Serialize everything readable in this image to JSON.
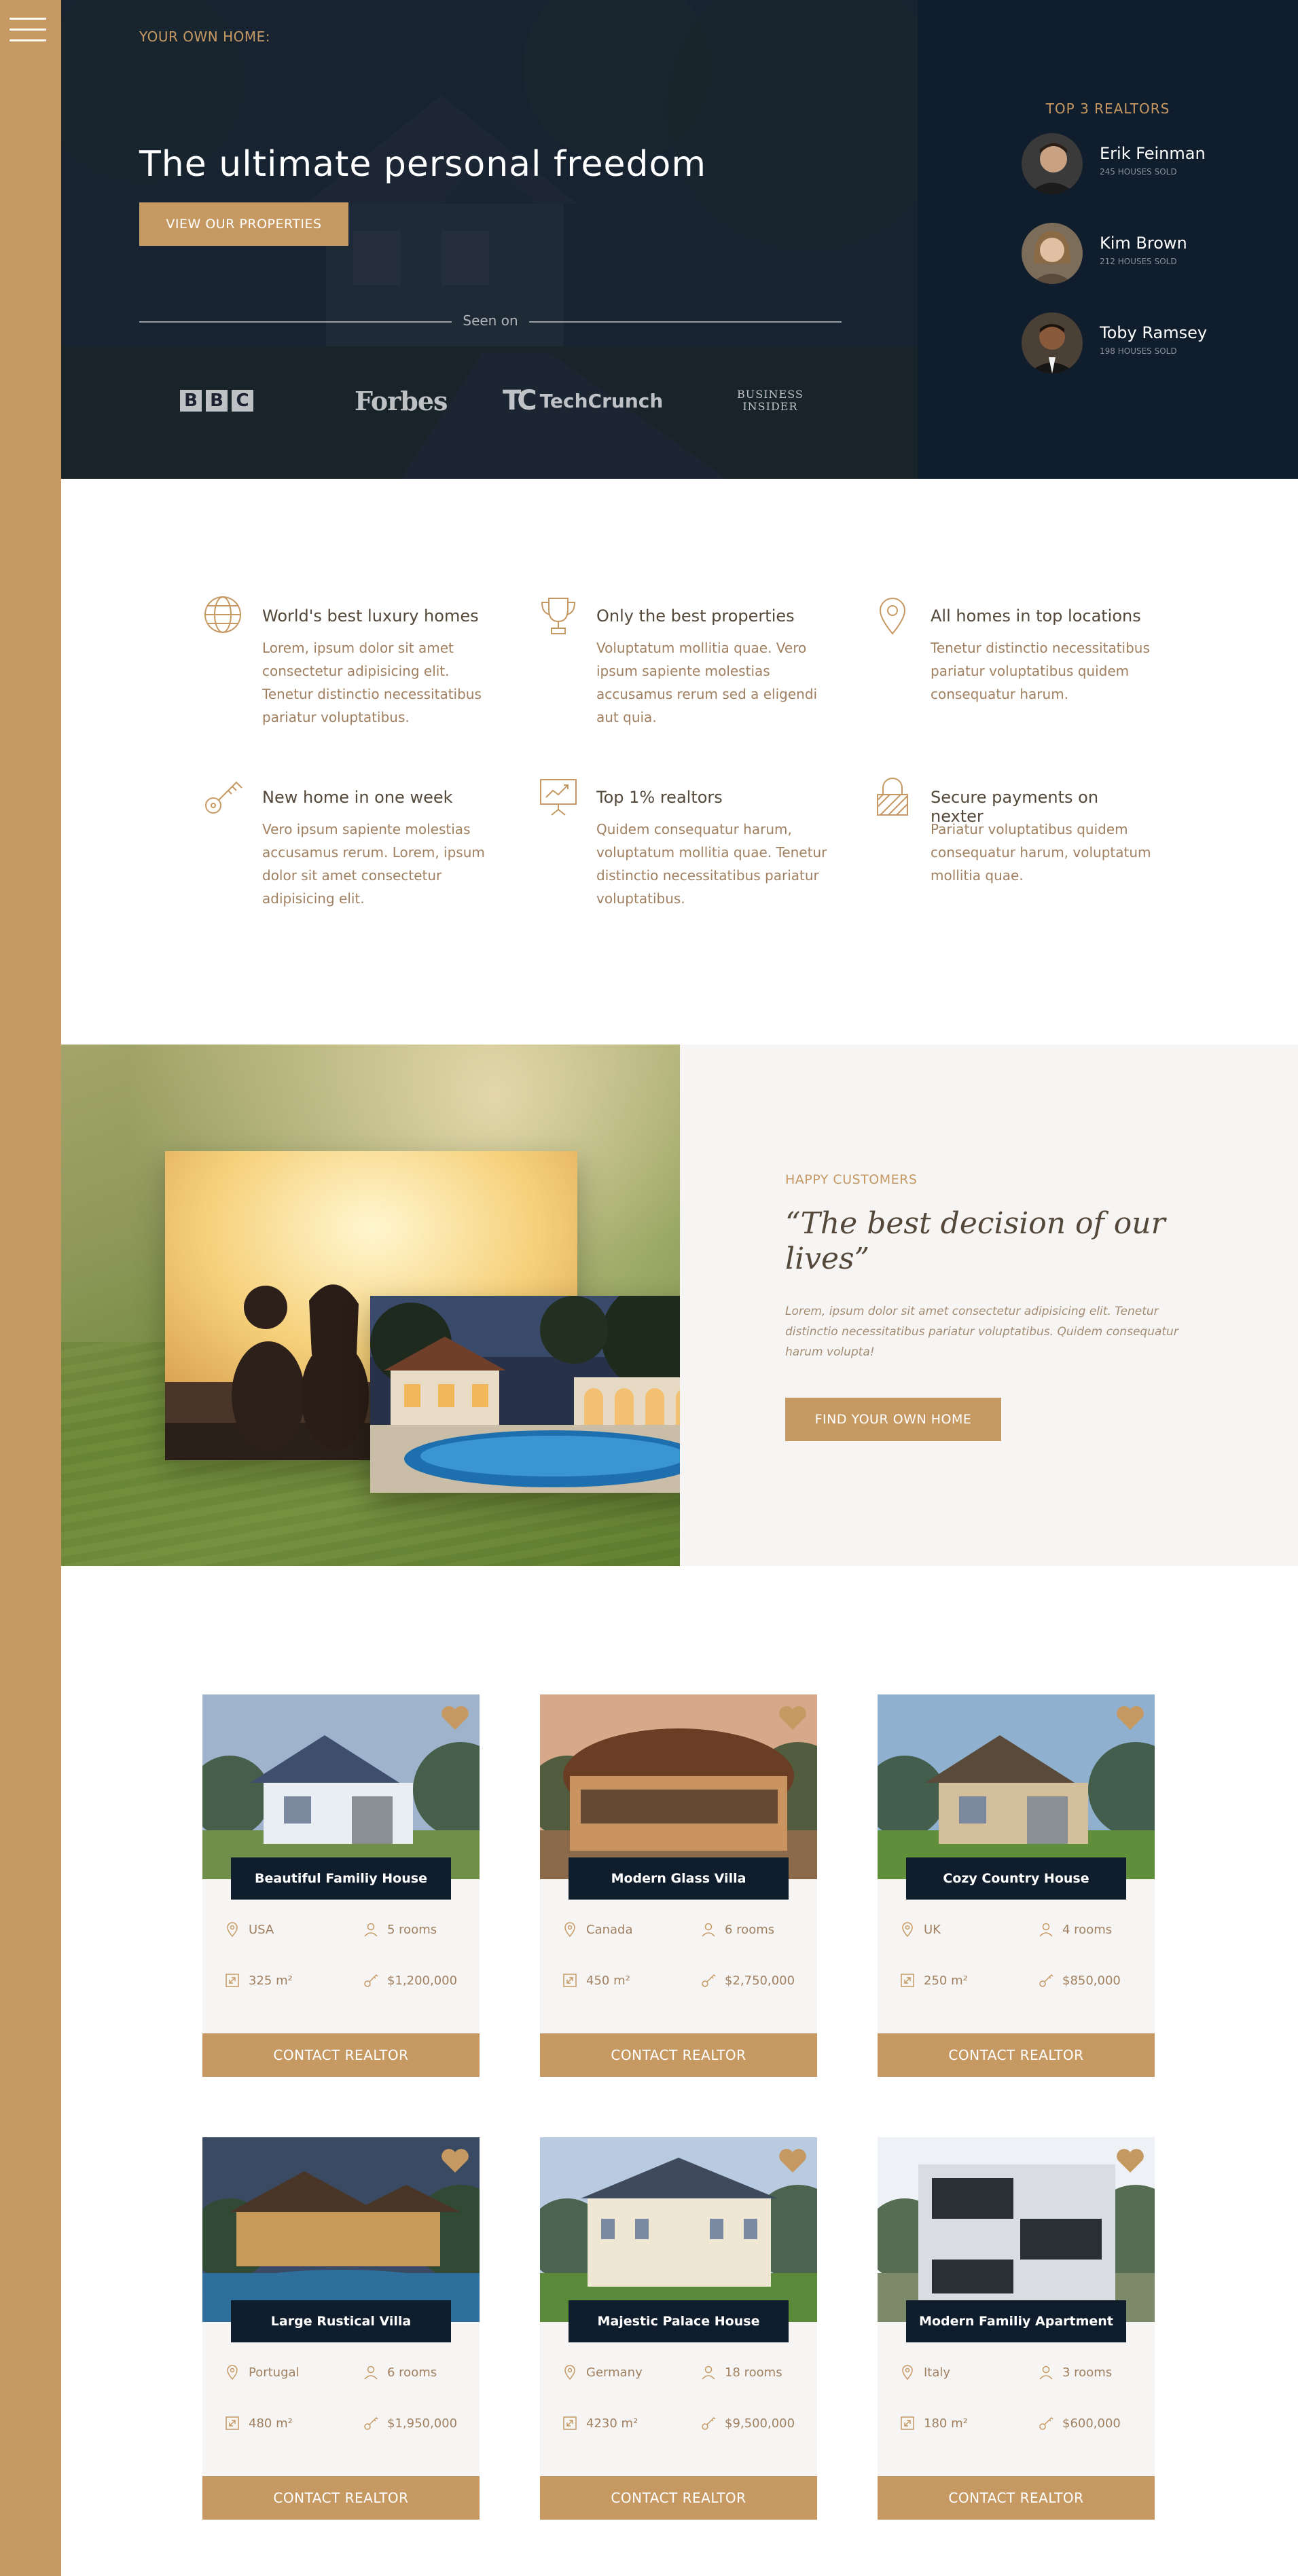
{
  "hero": {
    "tagline": "YOUR OWN HOME:",
    "title": "The ultimate personal freedom",
    "cta": "VIEW OUR PROPERTIES",
    "seen_on": "Seen on",
    "logos": {
      "bbc": [
        "B",
        "B",
        "C"
      ],
      "forbes": "Forbes",
      "techcrunch_mark": "TC",
      "techcrunch": "TechCrunch",
      "bi_line1": "BUSINESS",
      "bi_line2": "INSIDER"
    }
  },
  "realtors": {
    "title": "TOP 3 REALTORS",
    "list": [
      {
        "name": "Erik Feinman",
        "sold": "245 HOUSES SOLD"
      },
      {
        "name": "Kim Brown",
        "sold": "212 HOUSES SOLD"
      },
      {
        "name": "Toby Ramsey",
        "sold": "198 HOUSES SOLD"
      }
    ]
  },
  "features": [
    {
      "icon": "globe-icon",
      "title": "World's best luxury homes",
      "text": "Lorem, ipsum dolor sit amet consectetur adipisicing elit. Tenetur distinctio necessitatibus pariatur voluptatibus."
    },
    {
      "icon": "trophy-icon",
      "title": "Only the best properties",
      "text": "Voluptatum mollitia quae. Vero ipsum sapiente molestias accusamus rerum sed a eligendi aut quia."
    },
    {
      "icon": "map-pin-icon",
      "title": "All homes in top locations",
      "text": "Tenetur distinctio necessitatibus pariatur voluptatibus quidem consequatur harum."
    },
    {
      "icon": "key-icon",
      "title": "New home in one week",
      "text": "Vero ipsum sapiente molestias accusamus rerum. Lorem, ipsum dolor sit amet consectetur adipisicing elit."
    },
    {
      "icon": "presentation-chart-icon",
      "title": "Top 1% realtors",
      "text": "Quidem consequatur harum, voluptatum mollitia quae. Tenetur distinctio necessitatibus pariatur voluptatibus."
    },
    {
      "icon": "padlock-icon",
      "title": "Secure payments on nexter",
      "text": "Pariatur voluptatibus quidem consequatur harum, voluptatum mollitia quae."
    }
  ],
  "story": {
    "subtitle": "HAPPY CUSTOMERS",
    "title": "“The best decision of our lives”",
    "text": "Lorem, ipsum dolor sit amet consectetur adipisicing elit. Tenetur distinctio necessitatibus pariatur voluptatibus. Quidem consequatur harum volupta!",
    "cta": "FIND YOUR OWN HOME"
  },
  "homes": [
    {
      "name": "Beautiful Familiy House",
      "country": "USA",
      "rooms": "5 rooms",
      "area": "325 m²",
      "price": "$1,200,000",
      "cta": "CONTACT REALTOR"
    },
    {
      "name": "Modern Glass Villa",
      "country": "Canada",
      "rooms": "6 rooms",
      "area": "450 m²",
      "price": "$2,750,000",
      "cta": "CONTACT REALTOR"
    },
    {
      "name": "Cozy Country House",
      "country": "UK",
      "rooms": "4 rooms",
      "area": "250 m²",
      "price": "$850,000",
      "cta": "CONTACT REALTOR"
    },
    {
      "name": "Large Rustical Villa",
      "country": "Portugal",
      "rooms": "6 rooms",
      "area": "480 m²",
      "price": "$1,950,000",
      "cta": "CONTACT REALTOR"
    },
    {
      "name": "Majestic Palace House",
      "country": "Germany",
      "rooms": "18 rooms",
      "area": "4230 m²",
      "price": "$9,500,000",
      "cta": "CONTACT REALTOR"
    },
    {
      "name": "Modern Familiy Apartment",
      "country": "Italy",
      "rooms": "3 rooms",
      "area": "180 m²",
      "price": "$600,000",
      "cta": "CONTACT REALTOR"
    }
  ],
  "colors": {
    "gold": "#c69963",
    "navy": "#101d2c",
    "cream": "#f7f5f3",
    "brown": "#54483a"
  }
}
